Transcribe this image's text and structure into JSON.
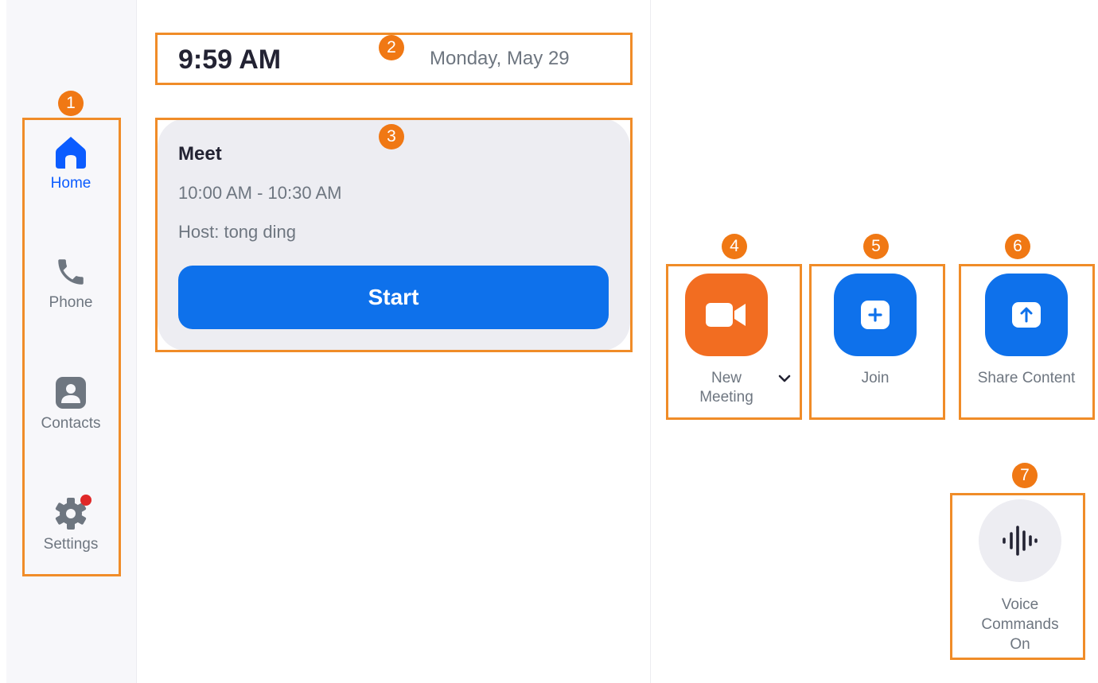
{
  "sidebar": {
    "items": [
      {
        "label": "Home",
        "icon": "home-icon",
        "active": true
      },
      {
        "label": "Phone",
        "icon": "phone-icon",
        "active": false
      },
      {
        "label": "Contacts",
        "icon": "contacts-icon",
        "active": false
      },
      {
        "label": "Settings",
        "icon": "gear-icon",
        "active": false,
        "notification_dot": true
      }
    ]
  },
  "header": {
    "time": "9:59 AM",
    "date": "Monday, May 29"
  },
  "meeting_card": {
    "title": "Meet",
    "time_range": "10:00 AM - 10:30 AM",
    "host": "Host: tong ding",
    "start_label": "Start"
  },
  "actions": {
    "new_meeting": {
      "label_line1": "New",
      "label_line2": "Meeting",
      "icon": "video-camera-icon",
      "color": "#f26d21"
    },
    "join": {
      "label": "Join",
      "icon": "plus-icon",
      "color": "#0e71eb"
    },
    "share": {
      "label": "Share Content",
      "icon": "upload-arrow-icon",
      "color": "#0e71eb"
    },
    "voice": {
      "label_line1": "Voice",
      "label_line2": "Commands",
      "label_line3": "On",
      "icon": "voice-waveform-icon"
    }
  },
  "callouts": [
    "1",
    "2",
    "3",
    "4",
    "5",
    "6",
    "7"
  ],
  "colors": {
    "accent": "#0e71eb",
    "callout": "#f08c28",
    "badge": "#f07814",
    "notification": "#e02828"
  }
}
